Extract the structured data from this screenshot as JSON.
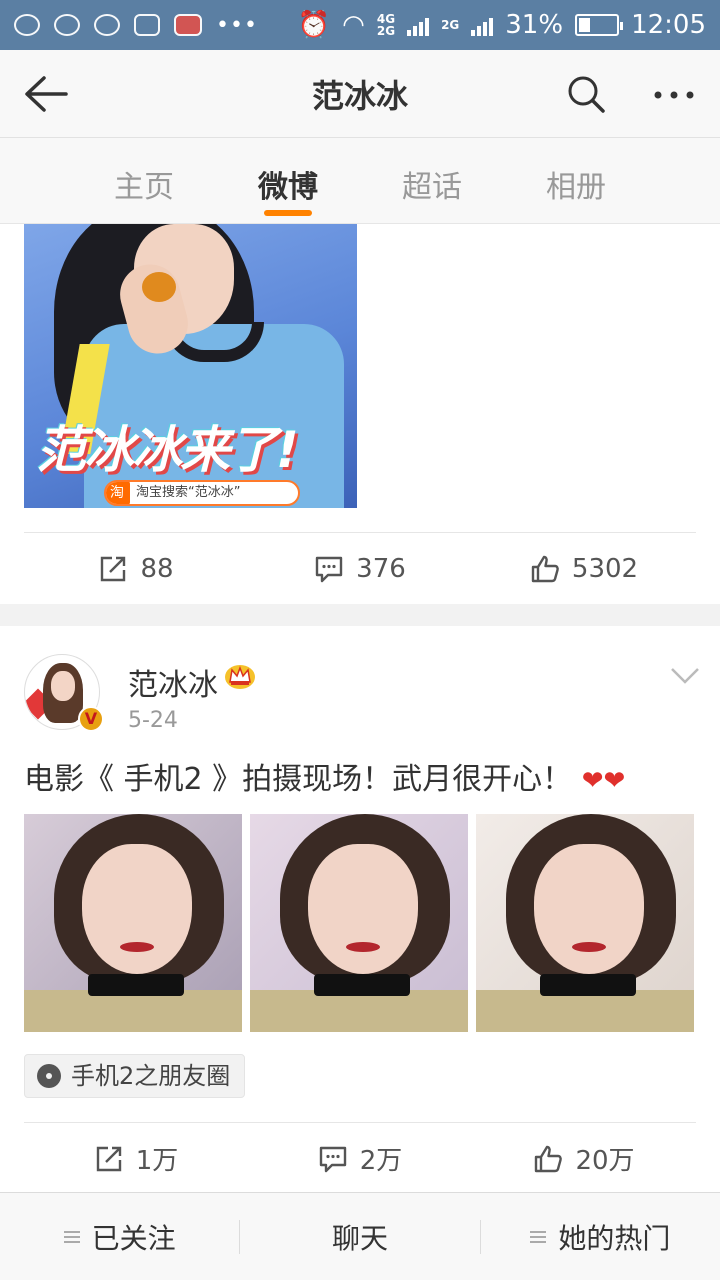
{
  "status_bar": {
    "network": "4G",
    "network2": "2G",
    "network_small": "2G",
    "battery": "31%",
    "battery_level": 0.31,
    "time": "12:05"
  },
  "header": {
    "title": "范冰冰"
  },
  "tabs": [
    {
      "label": "主页"
    },
    {
      "label": "微博"
    },
    {
      "label": "超话"
    },
    {
      "label": "相册"
    }
  ],
  "active_tab": "微博",
  "post1": {
    "poster_headline": "范冰冰来了!",
    "poster_search_brand": "淘",
    "poster_search_text": "淘宝搜索“范冰冰”",
    "reposts": "88",
    "comments": "376",
    "likes": "5302"
  },
  "post2": {
    "username": "范冰冰",
    "date": "5-24",
    "text": "电影《 手机2 》拍摄现场！武月很开心！",
    "emoji": "❤❤",
    "topic": "手机2之朋友圈",
    "reposts": "1万",
    "comments": "2万",
    "likes": "20万"
  },
  "bottom_bar": {
    "follow": "已关注",
    "chat": "聊天",
    "hot": "她的热门"
  },
  "colors": {
    "accent": "#ff8200",
    "status_bar": "#5b7fa3"
  }
}
